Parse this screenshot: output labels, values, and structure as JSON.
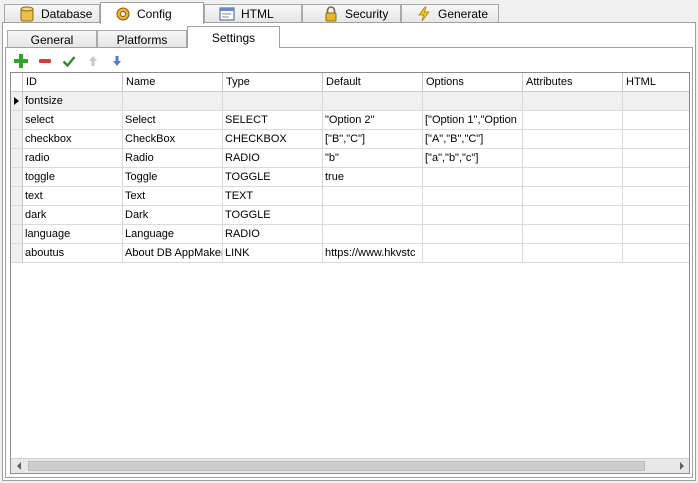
{
  "top_tabs": [
    {
      "label": "Database",
      "icon": "database-icon"
    },
    {
      "label": "Config",
      "icon": "config-gear-icon",
      "active": true
    },
    {
      "label": "HTML",
      "icon": "html-icon"
    },
    {
      "label": "Security",
      "icon": "lock-icon"
    },
    {
      "label": "Generate",
      "icon": "lightning-icon"
    }
  ],
  "sub_tabs": [
    {
      "label": "General"
    },
    {
      "label": "Platforms"
    },
    {
      "label": "Settings",
      "active": true
    }
  ],
  "toolbar": {
    "add": "add-icon",
    "remove": "remove-icon",
    "apply": "check-icon",
    "up": "arrow-up-icon",
    "down": "arrow-down-icon"
  },
  "columns": [
    "ID",
    "Name",
    "Type",
    "Default",
    "Options",
    "Attributes",
    "HTML"
  ],
  "rows": [
    [
      "fontsize",
      "",
      "",
      "",
      "",
      "",
      ""
    ],
    [
      "select",
      "Select",
      "SELECT",
      "\"Option 2\"",
      "[\"Option 1\",\"Option",
      "",
      ""
    ],
    [
      "checkbox",
      "CheckBox",
      "CHECKBOX",
      "[\"B\",\"C\"]",
      "[\"A\",\"B\",\"C\"]",
      "",
      ""
    ],
    [
      "radio",
      "Radio",
      "RADIO",
      "\"b\"",
      "[\"a\",\"b\",\"c\"]",
      "",
      ""
    ],
    [
      "toggle",
      "Toggle",
      "TOGGLE",
      "true",
      "",
      "",
      ""
    ],
    [
      "text",
      "Text",
      "TEXT",
      "",
      "",
      "",
      ""
    ],
    [
      "dark",
      "Dark",
      "TOGGLE",
      "",
      "",
      "",
      ""
    ],
    [
      "language",
      "Language",
      "RADIO",
      "",
      "",
      "",
      ""
    ],
    [
      "aboutus",
      "About DB AppMaker",
      "LINK",
      "https://www.hkvstc",
      "",
      "",
      ""
    ]
  ],
  "colors": {
    "add": "#2fa52f",
    "remove": "#d93a3a",
    "check": "#2e8b2e",
    "arrow_disabled": "#c8c8c8",
    "arrow_down": "#4a7fd8"
  }
}
